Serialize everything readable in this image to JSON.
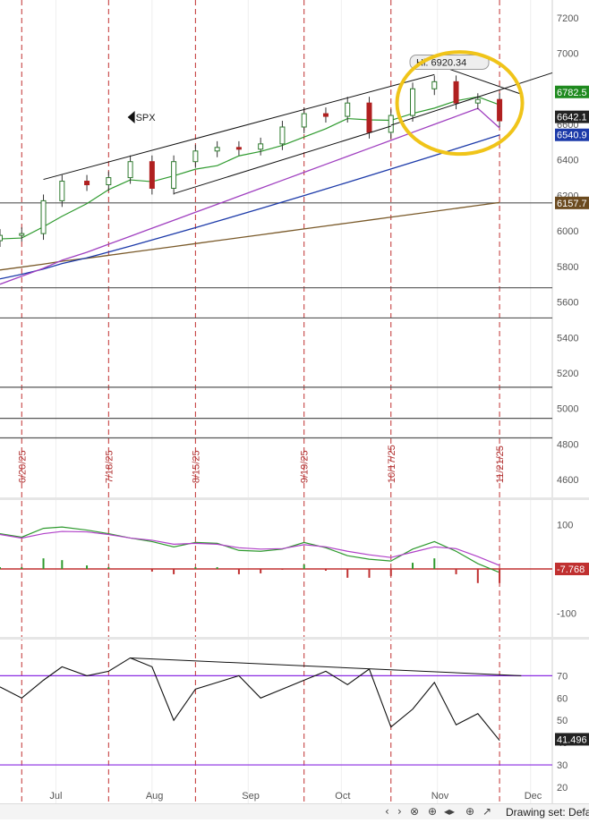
{
  "chart_data": [
    {
      "type": "candlestick",
      "symbol": "SPX",
      "ylim": [
        4500,
        7300
      ],
      "y_ticks": [
        4600,
        4800,
        5000,
        5200,
        5400,
        5600,
        5800,
        6000,
        6200,
        6400,
        6600,
        6800,
        7000,
        7200
      ],
      "x_months": [
        "Jul",
        "Aug",
        "Sep",
        "Oct",
        "Nov",
        "Dec"
      ],
      "x_month_positions": [
        "2025-07-01",
        "2025-08-01",
        "2025-09-01",
        "2025-10-01",
        "2025-11-01",
        "2025-12-01"
      ],
      "vertical_markers": [
        "6/20/25",
        "7/18/25",
        "8/15/25",
        "9/19/25",
        "10/17/25",
        "11/21/25"
      ],
      "horizontal_levels": [
        6157.7,
        5680,
        5510,
        5120,
        4945,
        4835
      ],
      "annotation": "Hi: 6920.34",
      "price_labels": [
        {
          "text": "6782.5",
          "value": 6782.5,
          "color": "#1f8a1f"
        },
        {
          "text": "6642.1",
          "value": 6642.1,
          "color": "#222222"
        },
        {
          "text": "6540.9",
          "value": 6540.9,
          "color": "#1c3aa9"
        },
        {
          "text": "6157.7",
          "value": 6157.7,
          "color": "#6b4a1f"
        }
      ],
      "highlight": "yellow-circle-around-recent-top",
      "series": [
        {
          "name": "close",
          "x": [
            "2025-06-13",
            "2025-06-20",
            "2025-06-27",
            "2025-07-03",
            "2025-07-11",
            "2025-07-18",
            "2025-07-25",
            "2025-08-01",
            "2025-08-08",
            "2025-08-15",
            "2025-08-22",
            "2025-08-29",
            "2025-09-05",
            "2025-09-12",
            "2025-09-19",
            "2025-09-26",
            "2025-10-03",
            "2025-10-10",
            "2025-10-17",
            "2025-10-24",
            "2025-10-31",
            "2025-11-07",
            "2025-11-14",
            "2025-11-21"
          ],
          "values": [
            5975,
            5985,
            6170,
            6280,
            6260,
            6300,
            6390,
            6240,
            6390,
            6450,
            6470,
            6460,
            6490,
            6585,
            6660,
            6645,
            6720,
            6555,
            6650,
            6800,
            6840,
            6720,
            6740,
            6620
          ]
        }
      ]
    },
    {
      "type": "line",
      "indicator": "MACD",
      "ylim": [
        -150,
        150
      ],
      "y_ticks": [
        100,
        -100
      ],
      "current_value_label": "-7.768",
      "series": [
        {
          "values": [
            80,
            72,
            92,
            95,
            88,
            80,
            70,
            62,
            50,
            60,
            58,
            42,
            40,
            45,
            60,
            48,
            30,
            22,
            18,
            45,
            62,
            40,
            12,
            -8
          ],
          "color": "#2e9a2e"
        },
        {
          "values": [
            78,
            70,
            80,
            85,
            84,
            78,
            70,
            65,
            56,
            58,
            56,
            48,
            45,
            46,
            55,
            50,
            40,
            32,
            26,
            38,
            50,
            46,
            28,
            8
          ],
          "color": "#b040c8"
        }
      ]
    },
    {
      "type": "line",
      "indicator": "RSI",
      "ylim": [
        20,
        85
      ],
      "y_ticks": [
        70,
        60,
        50,
        40,
        30,
        20
      ],
      "reference_lines": [
        70,
        30
      ],
      "current_value_label": "41.496",
      "values": [
        65,
        60,
        68,
        74,
        70,
        72,
        78,
        74,
        50,
        64,
        67,
        70,
        60,
        64,
        68,
        72,
        66,
        73,
        47,
        55,
        67,
        48,
        53,
        41
      ]
    }
  ],
  "toolbar": {
    "buttons": [
      "‹",
      "›",
      "⊗",
      "⊕",
      "◂▸",
      "⊕",
      "↗"
    ],
    "drawing_set_label": "Drawing set: Defa"
  }
}
